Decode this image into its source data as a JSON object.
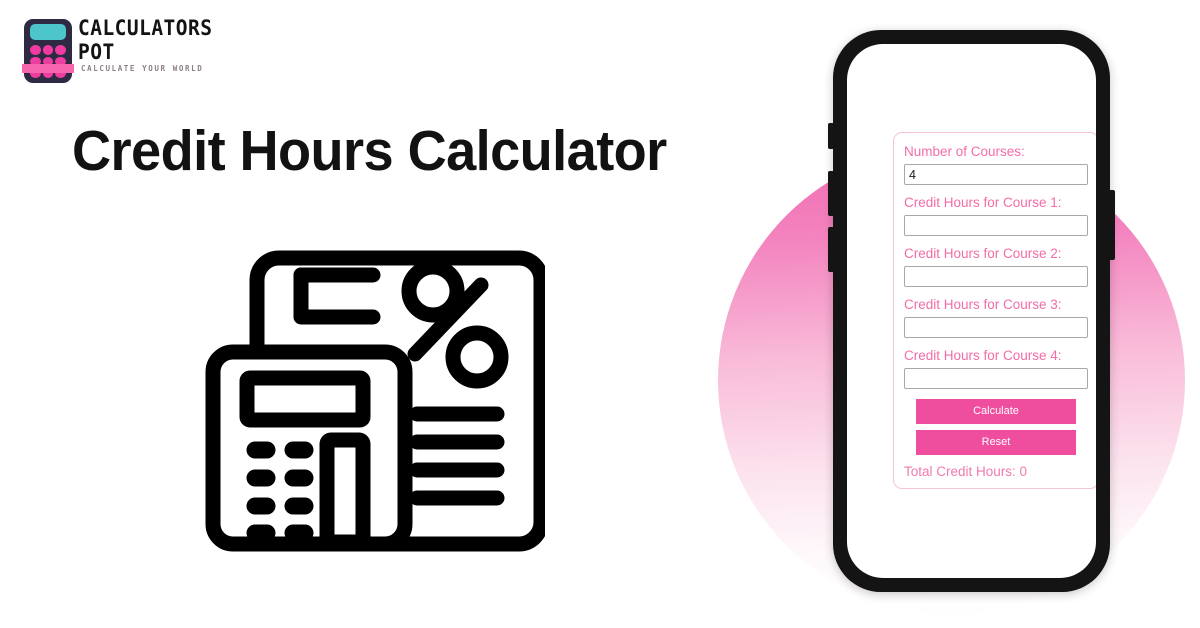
{
  "brand": {
    "name_line1": "CALCULATORS",
    "name_line2": "POT",
    "tagline": "CALCULATE YOUR WORLD",
    "mark_icon": "calculator-icon",
    "colors": {
      "body": "#2e2a44",
      "screen": "#4cc6cb",
      "keys": "#f03ba0",
      "bar": "#f765ae"
    }
  },
  "hero": {
    "title": "Credit Hours Calculator",
    "illustration_icon": "document-calculator-percent-icon"
  },
  "backdrop": {
    "shape": "circle",
    "gradient_from": "#f06bb2",
    "gradient_to": "#ffffff"
  },
  "phone": {
    "frame_color": "#141414",
    "screen_color": "#ffffff",
    "buttons": [
      {
        "name": "silent-switch"
      },
      {
        "name": "volume-up-button"
      },
      {
        "name": "volume-down-button"
      },
      {
        "name": "power-button"
      }
    ]
  },
  "calculator": {
    "card_border_color": "#f6c3da",
    "label_color": "#f36ca6",
    "button_color": "#ee4e9d",
    "fields": [
      {
        "label": "Number of Courses:",
        "value": "4",
        "placeholder": ""
      },
      {
        "label": "Credit Hours for Course 1:",
        "value": "",
        "placeholder": ""
      },
      {
        "label": "Credit Hours for Course 2:",
        "value": "",
        "placeholder": ""
      },
      {
        "label": "Credit Hours for Course 3:",
        "value": "",
        "placeholder": ""
      },
      {
        "label": "Credit Hours for Course 4:",
        "value": "",
        "placeholder": ""
      }
    ],
    "buttons": {
      "calculate": "Calculate",
      "reset": "Reset"
    },
    "result": "Total Credit Hours: 0"
  }
}
